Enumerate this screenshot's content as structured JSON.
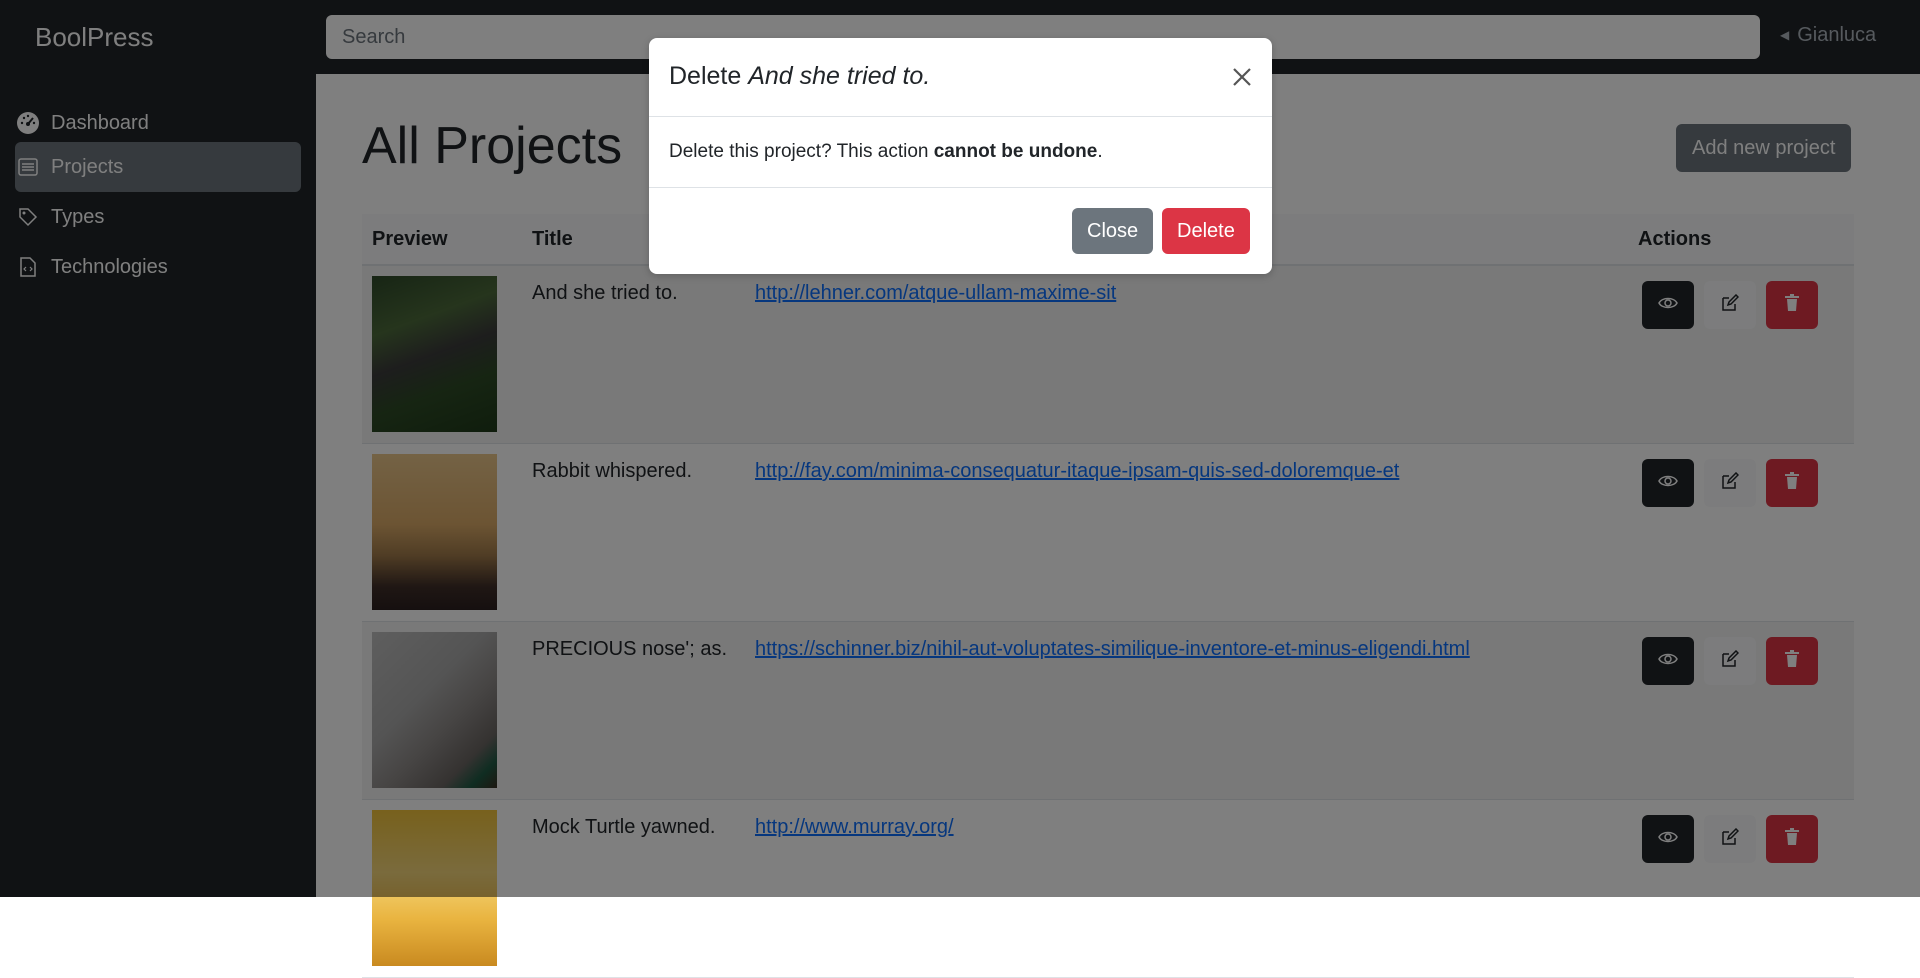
{
  "topbar": {
    "brand": "BoolPress",
    "search_placeholder": "Search",
    "user_name": "Gianluca"
  },
  "sidebar": {
    "items": [
      {
        "label": "Dashboard",
        "icon": "speedometer-icon",
        "active": false
      },
      {
        "label": "Projects",
        "icon": "list-icon",
        "active": true
      },
      {
        "label": "Types",
        "icon": "tag-icon",
        "active": false
      },
      {
        "label": "Technologies",
        "icon": "file-code-icon",
        "active": false
      }
    ]
  },
  "main": {
    "title": "All Projects",
    "add_button": "Add new project",
    "columns": {
      "preview": "Preview",
      "title": "Title",
      "actions": "Actions"
    },
    "rows": [
      {
        "title": "And she tried to.",
        "url": "http://lehner.com/atque-ullam-maxime-sit",
        "thumb": "forest-funicular"
      },
      {
        "title": "Rabbit whispered.",
        "url": "http://fay.com/minima-consequatur-itaque-ipsam-quis-sed-doloremque-et",
        "thumb": "sunset-field"
      },
      {
        "title": "PRECIOUS nose'; as.",
        "url": "https://schinner.biz/nihil-aut-voluptates-similique-inventore-et-minus-eligendi.html",
        "thumb": "cup-blanket"
      },
      {
        "title": "Mock Turtle yawned.",
        "url": "http://www.murray.org/",
        "thumb": "golden-light"
      }
    ]
  },
  "modal": {
    "title_prefix": "Delete ",
    "title_name": "And she tried to.",
    "body_prefix": "Delete this project? This action ",
    "body_bold": "cannot be undone",
    "body_suffix": ".",
    "close_label": "Close",
    "delete_label": "Delete"
  },
  "colors": {
    "dark": "#212529",
    "secondary": "#6c757d",
    "danger": "#dc3545",
    "link": "#0d6efd"
  }
}
